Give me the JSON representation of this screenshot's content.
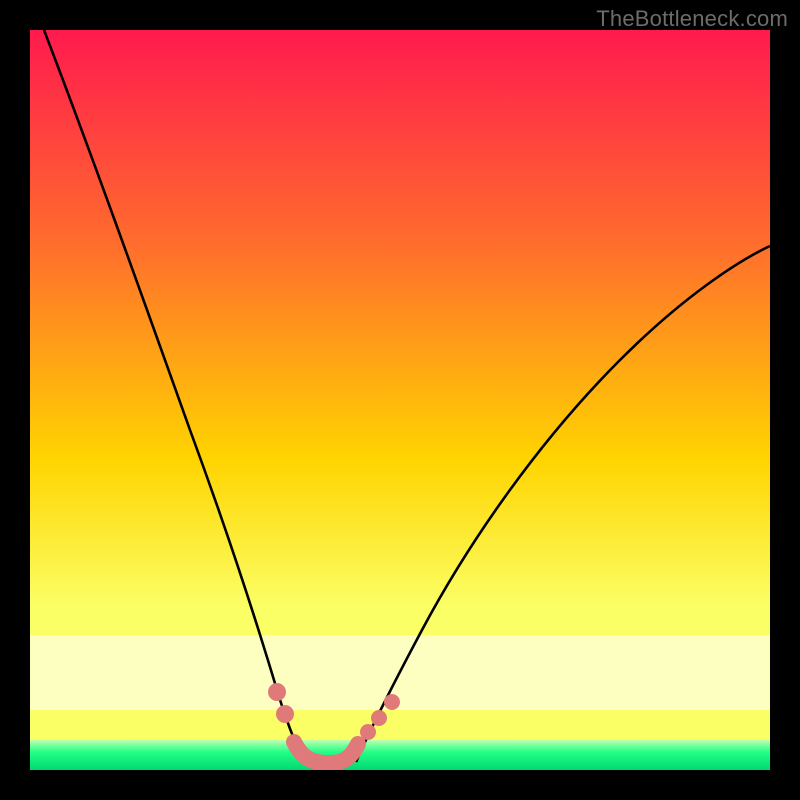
{
  "watermark": "TheBottleneck.com",
  "colors": {
    "gradient_top": "#ff1a4e",
    "gradient_mid1": "#ff6a2e",
    "gradient_mid2": "#ffd400",
    "gradient_low": "#fbff66",
    "band_pale": "#fdffc0",
    "band_green_light": "#bfffb0",
    "band_green": "#23ff86",
    "band_green_deep": "#00d870",
    "curve_stroke": "#000000",
    "marker": "#e07a7a",
    "frame": "#000000"
  },
  "chart_data": {
    "type": "line",
    "title": "",
    "xlabel": "",
    "ylabel": "",
    "xlim": [
      0,
      100
    ],
    "ylim": [
      0,
      100
    ],
    "series": [
      {
        "name": "left-curve",
        "x": [
          2,
          6,
          10,
          14,
          18,
          22,
          26,
          29,
          31,
          33,
          34.5,
          36,
          37
        ],
        "y": [
          100,
          88,
          75,
          62,
          50,
          38,
          27,
          18,
          12,
          8,
          5,
          2.5,
          1
        ]
      },
      {
        "name": "right-curve",
        "x": [
          44,
          46,
          49,
          53,
          58,
          64,
          71,
          79,
          88,
          97,
          100
        ],
        "y": [
          1,
          3,
          6,
          11,
          18,
          27,
          37,
          48,
          58,
          67,
          70
        ]
      },
      {
        "name": "valley-floor",
        "x": [
          37,
          39,
          41,
          43,
          44
        ],
        "y": [
          1,
          0.2,
          0.2,
          0.4,
          1
        ]
      }
    ],
    "markers": [
      {
        "name": "left-dot-upper",
        "x": 33.5,
        "y": 10
      },
      {
        "name": "left-dot-lower",
        "x": 34.8,
        "y": 7.5
      },
      {
        "name": "right-dot-1",
        "x": 45.5,
        "y": 4.5
      },
      {
        "name": "right-dot-2",
        "x": 46.8,
        "y": 6
      },
      {
        "name": "right-dot-3",
        "x": 48.3,
        "y": 8
      }
    ],
    "valley_tube": {
      "x": [
        36,
        37.5,
        39,
        41,
        42.5,
        44
      ],
      "y": [
        3,
        1.2,
        0.7,
        0.7,
        1.2,
        3
      ]
    }
  }
}
